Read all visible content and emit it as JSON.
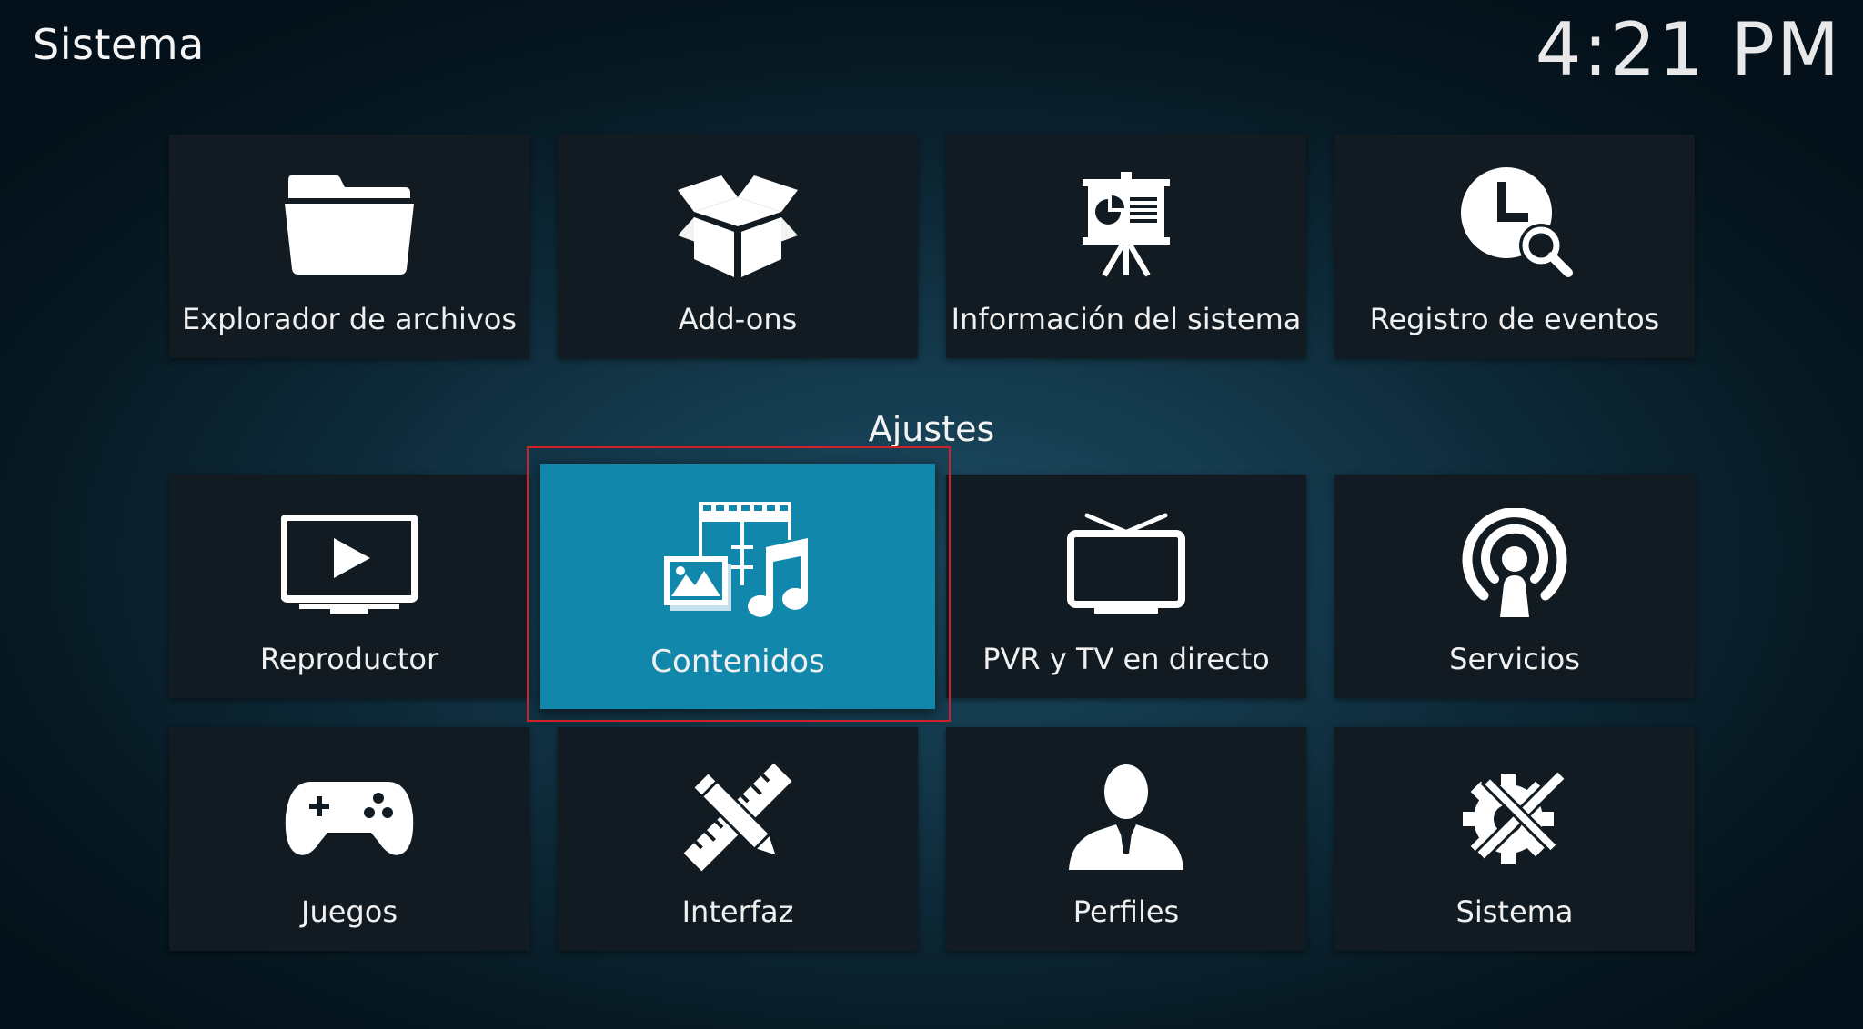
{
  "header": {
    "title": "Sistema"
  },
  "clock": "4:21 PM",
  "section": {
    "label": "Ajustes"
  },
  "top_row": [
    {
      "label": "Explorador de archivos",
      "icon": "folder-icon"
    },
    {
      "label": "Add-ons",
      "icon": "open-box-icon"
    },
    {
      "label": "Información del sistema",
      "icon": "presentation-easel-icon"
    },
    {
      "label": "Registro de eventos",
      "icon": "clock-search-icon"
    }
  ],
  "settings_row1": [
    {
      "label": "Reproductor",
      "icon": "tv-play-icon"
    },
    {
      "label": "Contenidos",
      "icon": "media-library-icon",
      "focused": true
    },
    {
      "label": "PVR y TV en directo",
      "icon": "antenna-tv-icon"
    },
    {
      "label": "Servicios",
      "icon": "broadcast-icon"
    }
  ],
  "settings_row2": [
    {
      "label": "Juegos",
      "icon": "gamepad-icon"
    },
    {
      "label": "Interfaz",
      "icon": "pencil-ruler-icon"
    },
    {
      "label": "Perfiles",
      "icon": "user-icon"
    },
    {
      "label": "Sistema",
      "icon": "gear-tools-icon"
    }
  ],
  "colors": {
    "tile": "#111b21",
    "focused_tile": "#1187ab",
    "focus_outline": "#d0202a",
    "text": "#f0f0f0"
  }
}
